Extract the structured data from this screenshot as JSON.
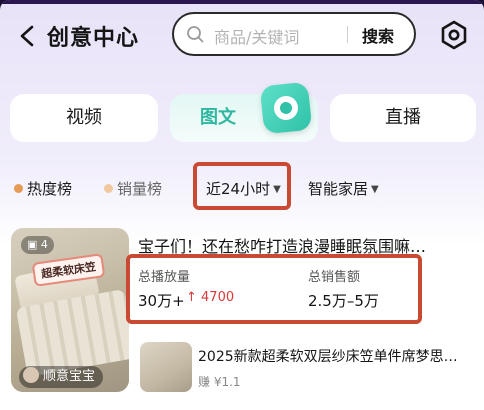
{
  "header": {
    "title": "创意中心",
    "search_placeholder": "商品/关键词",
    "search_button": "搜索"
  },
  "tabs": [
    {
      "label": "视频",
      "active": false
    },
    {
      "label": "图文",
      "active": true
    },
    {
      "label": "直播",
      "active": false
    }
  ],
  "filters": {
    "hot": "热度榜",
    "sales": "销量榜",
    "time": "近24小时",
    "category": "智能家居"
  },
  "card": {
    "image_count": "4",
    "thumb_sticker": "超柔软床笠",
    "author": "顺意宝宝",
    "title": "宝子们！还在愁咋打造浪漫睡眠氛围嘛…",
    "plays_label": "总播放量",
    "plays_value": "30万+",
    "plays_growth": "4700",
    "sales_label": "总销售额",
    "sales_value": "2.5万–5万",
    "product_title": "2025新款超柔软双层纱床笠单件席梦思…",
    "product_earn": "赚 ¥1.1"
  },
  "colors": {
    "accent_teal": "#2fb7a0",
    "highlight_red": "#c94a33",
    "growth_red": "#d83a3a"
  }
}
